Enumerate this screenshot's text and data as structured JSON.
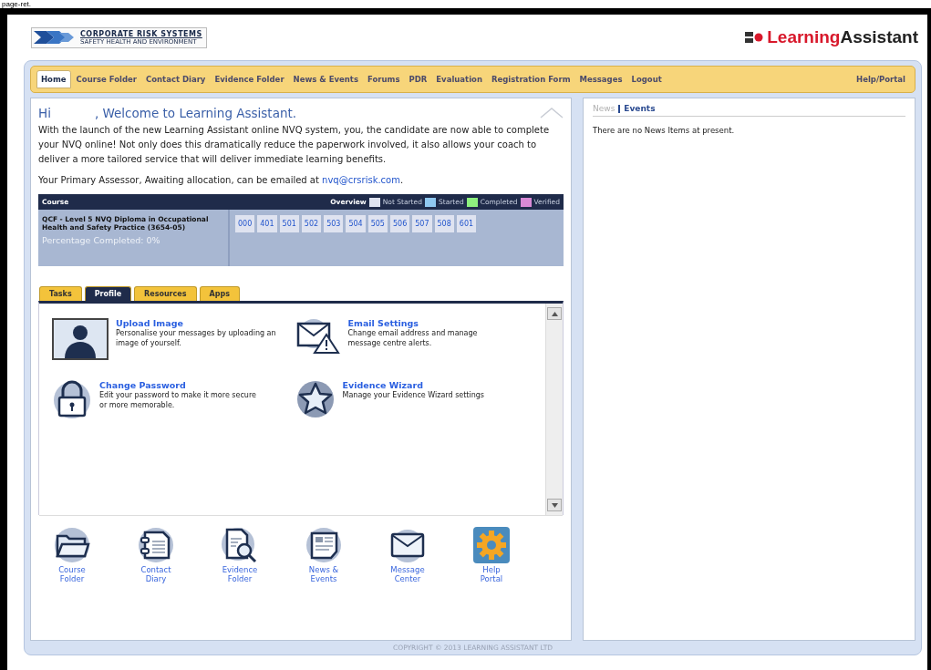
{
  "page_caption": "page-ret.",
  "brand": {
    "line1": "CORPORATE RISK SYSTEMS",
    "line2": "SAFETY HEALTH AND ENVIRONMENT"
  },
  "product": {
    "part1": "Learning",
    "part2": "Assistant"
  },
  "nav": [
    {
      "label": "Home",
      "selected": true
    },
    {
      "label": "Course Folder",
      "selected": false
    },
    {
      "label": "Contact Diary",
      "selected": false
    },
    {
      "label": "Evidence Folder",
      "selected": false
    },
    {
      "label": "News & Events",
      "selected": false
    },
    {
      "label": "Forums",
      "selected": false
    },
    {
      "label": "PDR",
      "selected": false
    },
    {
      "label": "Evaluation",
      "selected": false
    },
    {
      "label": "Registration Form",
      "selected": false
    },
    {
      "label": "Messages",
      "selected": false
    },
    {
      "label": "Logout",
      "selected": false
    }
  ],
  "nav_right": "Help/Portal",
  "greeting": {
    "hi": "Hi",
    "rest": ", Welcome to Learning Assistant."
  },
  "intro": "With the launch of the new Learning Assistant online NVQ system, you, the candidate are now able to complete your NVQ online! Not only does this dramatically reduce the paperwork involved, it also allows your coach to deliver a more tailored service that will deliver immediate learning benefits.",
  "assessor": {
    "text": "Your Primary Assessor, Awaiting allocation, can be emailed at",
    "email": "nvq@crsrisk.com",
    "end": "."
  },
  "course_table": {
    "col_course": "Course",
    "col_overview": "Overview",
    "legend": [
      {
        "label": "Not Started",
        "color": "#dfe3f0"
      },
      {
        "label": "Started",
        "color": "#8fc8f0"
      },
      {
        "label": "Completed",
        "color": "#8ef07e"
      },
      {
        "label": "Verified",
        "color": "#d98ad6"
      }
    ],
    "course_name": "QCF - Level 5 NVQ Diploma in Occupational Health and Safety Practice (3654-05)",
    "percentage": "Percentage Completed: 0%",
    "units": [
      {
        "code": "000",
        "color": "#dfe3f0"
      },
      {
        "code": "401",
        "color": "#dfe3f0"
      },
      {
        "code": "501",
        "color": "#dfe3f0"
      },
      {
        "code": "502",
        "color": "#dfe3f0"
      },
      {
        "code": "503",
        "color": "#dfe3f0"
      },
      {
        "code": "504",
        "color": "#dfe3f0"
      },
      {
        "code": "505",
        "color": "#dfe3f0"
      },
      {
        "code": "506",
        "color": "#dfe3f0"
      },
      {
        "code": "507",
        "color": "#dfe3f0"
      },
      {
        "code": "508",
        "color": "#dfe3f0"
      },
      {
        "code": "601",
        "color": "#dfe3f0"
      }
    ]
  },
  "tabs": [
    {
      "label": "Tasks",
      "selected": false
    },
    {
      "label": "Profile",
      "selected": true
    },
    {
      "label": "Resources",
      "selected": false
    },
    {
      "label": "Apps",
      "selected": false
    }
  ],
  "profile_items": [
    {
      "kind": "avatar",
      "title": "Upload Image",
      "desc": "Personalise your messages by uploading an image of yourself."
    },
    {
      "kind": "email",
      "title": "Email Settings",
      "desc": "Change email address and manage message centre alerts."
    },
    {
      "kind": "lock",
      "title": "Change Password",
      "desc": "Edit your password to make it more secure or more memorable."
    },
    {
      "kind": "star",
      "title": "Evidence Wizard",
      "desc": "Manage your Evidence Wizard settings"
    }
  ],
  "quick_links": [
    {
      "kind": "folder",
      "label": "Course Folder"
    },
    {
      "kind": "diary",
      "label": "Contact Diary"
    },
    {
      "kind": "evidence",
      "label": "Evidence Folder"
    },
    {
      "kind": "news",
      "label": "News & Events"
    },
    {
      "kind": "mail",
      "label": "Message Center"
    },
    {
      "kind": "gear",
      "label": "Help Portal"
    }
  ],
  "side_tabs": [
    {
      "label": "News",
      "selected": false
    },
    {
      "label": "Events",
      "selected": true
    }
  ],
  "side_message": "There are no News Items at present.",
  "footer": "COPYRIGHT © 2013 LEARNING ASSISTANT LTD"
}
